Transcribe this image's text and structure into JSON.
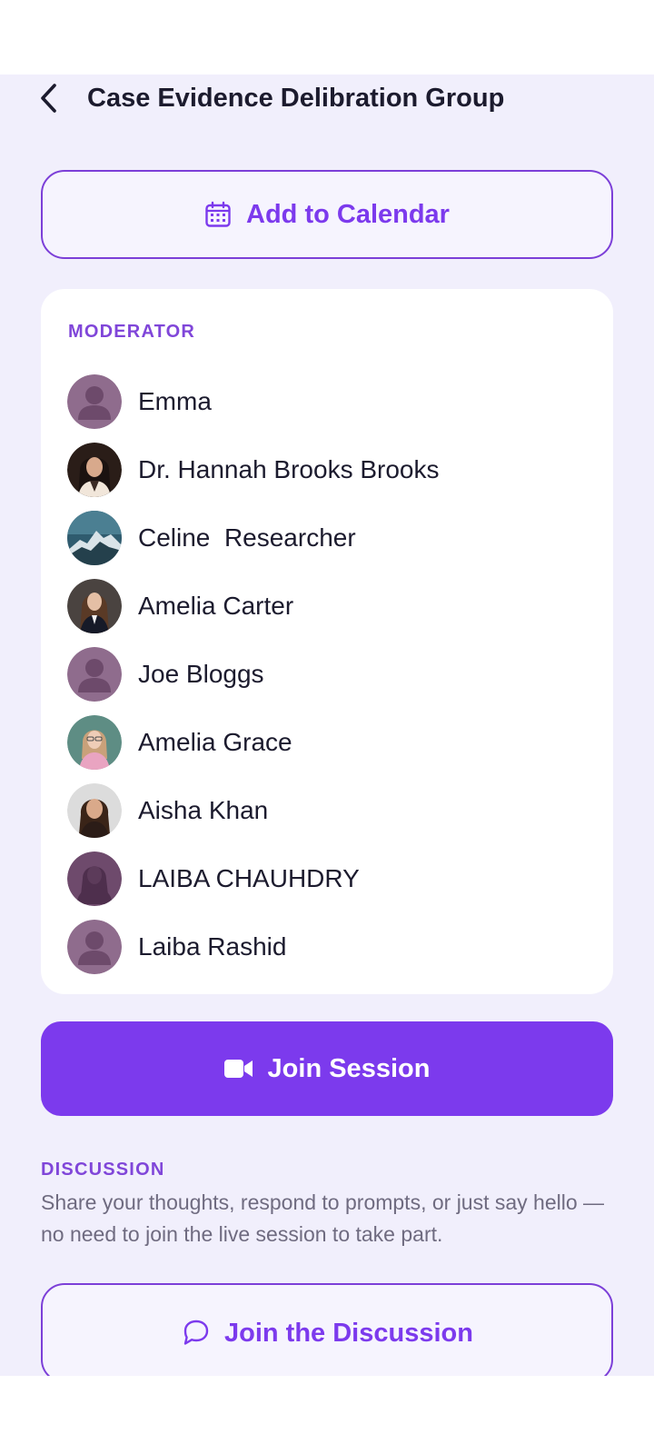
{
  "header": {
    "title": "Case Evidence Delibration Group",
    "back_icon": "chevron-left-icon"
  },
  "calendar_button": {
    "label": "Add to Calendar",
    "icon": "calendar-icon"
  },
  "moderator": {
    "section_label": "MODERATOR",
    "members": [
      {
        "name": "Emma",
        "avatar": "placeholder-person"
      },
      {
        "name": "Dr. Hannah Brooks Brooks",
        "avatar": "photo"
      },
      {
        "name": "Celine  Researcher",
        "avatar": "mountain-photo"
      },
      {
        "name": "Amelia Carter",
        "avatar": "photo"
      },
      {
        "name": "Joe Bloggs",
        "avatar": "placeholder-person"
      },
      {
        "name": "Amelia Grace",
        "avatar": "photo"
      },
      {
        "name": "Aisha Khan",
        "avatar": "photo"
      },
      {
        "name": "LAIBA CHAUHDRY",
        "avatar": "placeholder-woman"
      },
      {
        "name": "Laiba Rashid",
        "avatar": "placeholder-person"
      }
    ]
  },
  "join_session": {
    "label": "Join Session",
    "icon": "video-camera-icon"
  },
  "discussion": {
    "section_label": "DISCUSSION",
    "description": "Share your thoughts, respond to prompts, or just say hello — no need to join the live session to take part.",
    "button_label": "Join the Discussion",
    "button_icon": "chat-bubble-icon"
  },
  "colors": {
    "accent": "#7c3aed",
    "background": "#f1effc",
    "card": "#ffffff",
    "placeholder_avatar": "#8f6c8d"
  }
}
